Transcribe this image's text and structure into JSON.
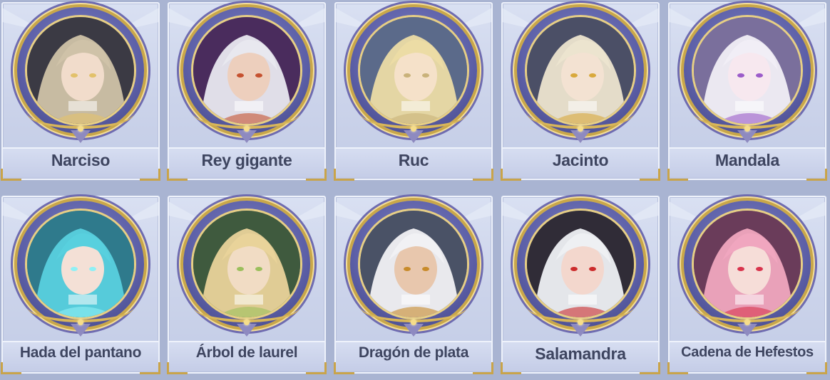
{
  "characters": [
    {
      "name": "Narciso",
      "palette": {
        "bg": "#3b3a44",
        "hair": "#cfc2a8",
        "skin": "#f1dccb",
        "accent": "#e2c16a"
      }
    },
    {
      "name": "Rey gigante",
      "palette": {
        "bg": "#4a2c5d",
        "hair": "#e8e8ef",
        "skin": "#edcfbd",
        "accent": "#c5512f"
      }
    },
    {
      "name": "Ruc",
      "palette": {
        "bg": "#5b6a8a",
        "hair": "#ecdca5",
        "skin": "#f5e1c9",
        "accent": "#c9b27a"
      }
    },
    {
      "name": "Jacinto",
      "palette": {
        "bg": "#4b4f66",
        "hair": "#ece4cf",
        "skin": "#f3e2d2",
        "accent": "#d8a93c"
      }
    },
    {
      "name": "Mandala",
      "palette": {
        "bg": "#7a6f9c",
        "hair": "#f1eef6",
        "skin": "#f7e8ef",
        "accent": "#9b5bc9"
      }
    },
    {
      "name": "Hada del pantano",
      "palette": {
        "bg": "#2f7a8c",
        "hair": "#58d0de",
        "skin": "#f4e0d6",
        "accent": "#8ff0f5"
      }
    },
    {
      "name": "Árbol de laurel",
      "palette": {
        "bg": "#3f5a3e",
        "hair": "#e9d39a",
        "skin": "#f1dcc4",
        "accent": "#9bbf5c"
      }
    },
    {
      "name": "Dragón de plata",
      "palette": {
        "bg": "#4a5266",
        "hair": "#f1f1f4",
        "skin": "#e8c7ad",
        "accent": "#c88b2a"
      }
    },
    {
      "name": "Salamandra",
      "palette": {
        "bg": "#302c37",
        "hair": "#eef0f3",
        "skin": "#f3d7cd",
        "accent": "#cc2c2c"
      }
    },
    {
      "name": "Cadena de Hefestos",
      "palette": {
        "bg": "#6a3c5a",
        "hair": "#f0a6bf",
        "skin": "#f6ddd8",
        "accent": "#d9334c"
      }
    }
  ]
}
